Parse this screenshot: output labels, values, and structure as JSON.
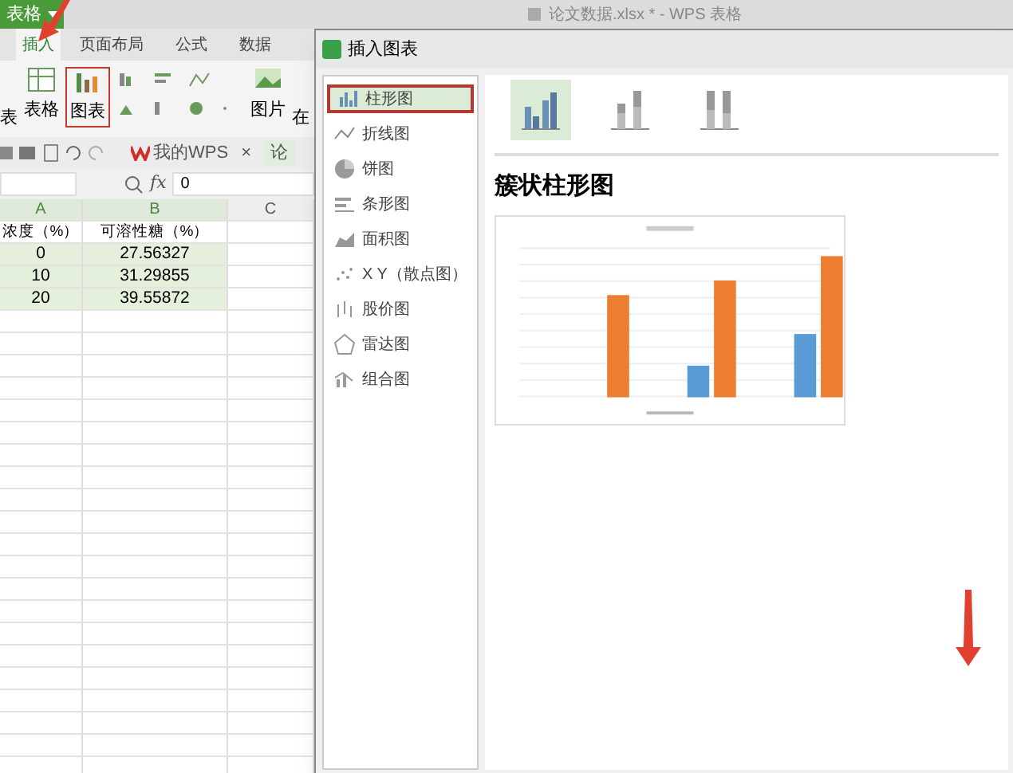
{
  "app_button": {
    "label": "表格"
  },
  "window": {
    "title": "论文数据.xlsx * - WPS 表格"
  },
  "ribbon_tabs": [
    {
      "label": "插入",
      "selected": true
    },
    {
      "label": "页面布局",
      "selected": false
    },
    {
      "label": "公式",
      "selected": false
    },
    {
      "label": "数据",
      "selected": false
    }
  ],
  "ribbon": {
    "left_label": "表",
    "table_label": "表格",
    "chart_label": "图表",
    "picture_label": "图片",
    "cut_label": "在"
  },
  "doc_tabs": [
    {
      "label": "我的WPS",
      "close": "×"
    },
    {
      "label": "论"
    }
  ],
  "formula_bar": {
    "fx": "fx",
    "value": "0"
  },
  "sheet": {
    "columns": [
      "A",
      "B",
      "C"
    ],
    "rows": [
      [
        "浓度（%）",
        "可溶性糖（%）"
      ],
      [
        "0",
        "27.56327"
      ],
      [
        "10",
        "31.29855"
      ],
      [
        "20",
        "39.55872"
      ]
    ]
  },
  "dialog": {
    "title": "插入图表",
    "chart_types": [
      {
        "label": "柱形图",
        "selected": true
      },
      {
        "label": "折线图",
        "selected": false
      },
      {
        "label": "饼图",
        "selected": false
      },
      {
        "label": "条形图",
        "selected": false
      },
      {
        "label": "面积图",
        "selected": false
      },
      {
        "label": "X Y（散点图）",
        "selected": false
      },
      {
        "label": "股价图",
        "selected": false
      },
      {
        "label": "雷达图",
        "selected": false
      },
      {
        "label": "组合图",
        "selected": false
      }
    ],
    "subtypes": [
      {
        "selected": true
      },
      {
        "selected": false
      },
      {
        "selected": false
      }
    ],
    "subtype_title": "簇状柱形图"
  }
}
